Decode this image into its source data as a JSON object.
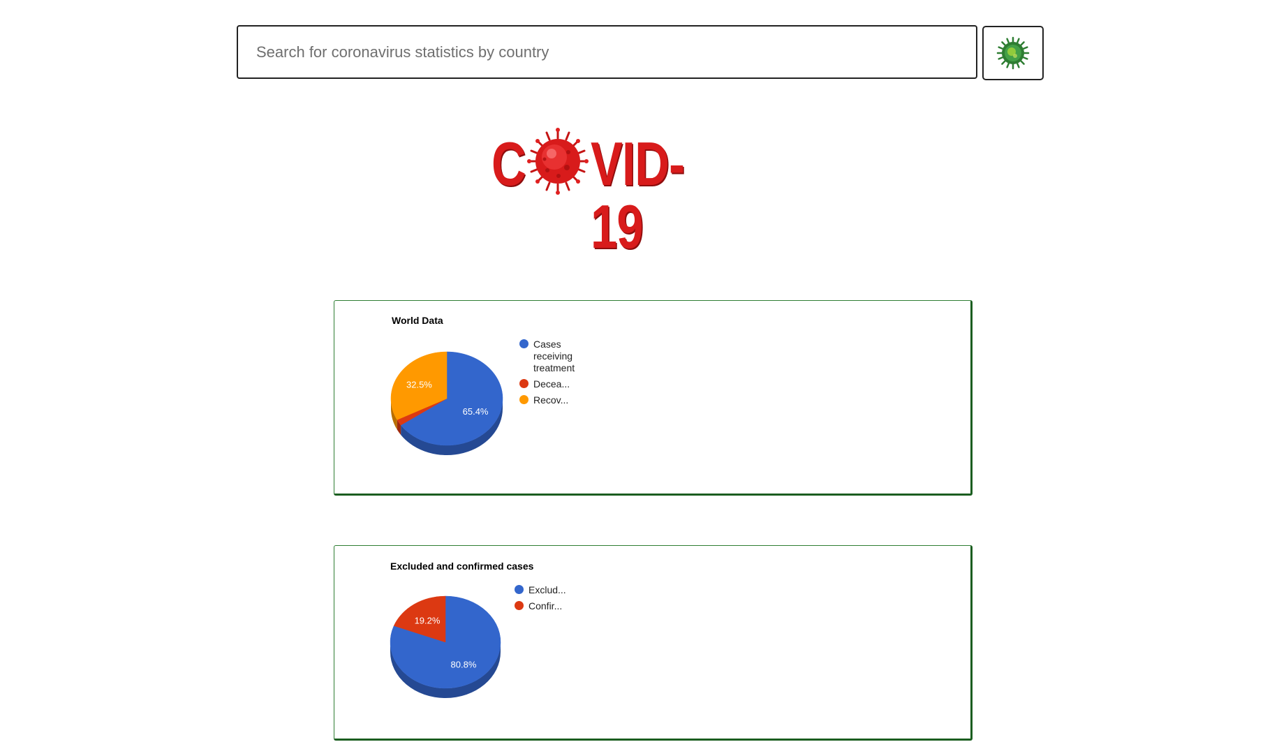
{
  "search": {
    "placeholder": "Search for coronavirus statistics by country",
    "button_icon": "virus-icon"
  },
  "logo": {
    "text_before": "C",
    "icon": "virus-icon",
    "text_after": "VID-19",
    "color": "#d81b1b"
  },
  "chart_data": [
    {
      "type": "pie",
      "title": "World Data",
      "slices": [
        {
          "label": "Cases receiving treatment",
          "legend_text": "Cases receiving treatment",
          "value": 65.4,
          "value_label": "65.4%",
          "color": "#3366cc",
          "show_label": true
        },
        {
          "label": "Decea...",
          "legend_text": "Decea...",
          "value": 2.1,
          "value_label": "",
          "color": "#dc3912",
          "show_label": false
        },
        {
          "label": "Recov...",
          "legend_text": "Recov...",
          "value": 32.5,
          "value_label": "32.5%",
          "color": "#ff9900",
          "show_label": true
        }
      ],
      "legend_position": "right",
      "is_3d": true
    },
    {
      "type": "pie",
      "title": "Excluded and confirmed cases",
      "slices": [
        {
          "label": "Exclud...",
          "legend_text": "Exclud...",
          "value": 80.8,
          "value_label": "80.8%",
          "color": "#3366cc",
          "show_label": true
        },
        {
          "label": "Confir...",
          "legend_text": "Confir...",
          "value": 19.2,
          "value_label": "19.2%",
          "color": "#dc3912",
          "show_label": true
        }
      ],
      "legend_position": "right",
      "is_3d": true
    }
  ]
}
